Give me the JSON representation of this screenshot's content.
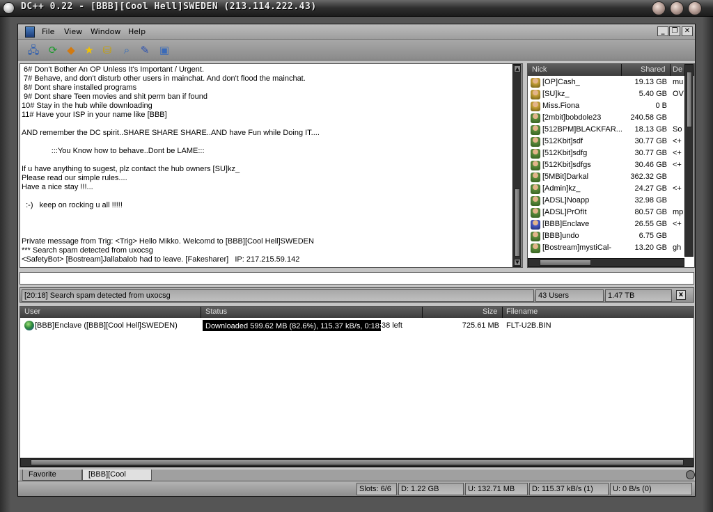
{
  "window": {
    "title": "DC++ 0.22 - [BBB][Cool Hell]SWEDEN (213.114.222.43)"
  },
  "menu": {
    "items": [
      "File",
      "View",
      "Window",
      "Help"
    ]
  },
  "toolbar": {
    "buttons": [
      "connect-icon",
      "refresh-icon",
      "follow-redirect-icon",
      "favorites-icon",
      "download-queue-icon",
      "search-icon",
      "notepad-icon",
      "settings-icon"
    ]
  },
  "chat": {
    "lines": [
      " 6# Don't Bother An OP Unless It's Important / Urgent.",
      " 7# Behave, and don't disturb other users in mainchat. And don't flood the mainchat.",
      " 8# Dont share installed programs",
      " 9# Dont share Teen movies and shit perm ban if found",
      "10# Stay in the hub while downloading",
      "11# Have your ISP in your name like [BBB]",
      "",
      "AND remember the DC spirit..SHARE SHARE SHARE..AND have Fun while Doing IT....",
      "",
      "              :::You Know how to behave..Dont be LAME:::",
      "",
      "If u have anything to sugest, plz contact the hub owners [SU]kz_",
      "Please read our simple rules....",
      "Have a nice stay !!!...",
      "",
      "  :-)   keep on rocking u all !!!!!",
      "",
      "",
      "",
      "Private message from Trig: <Trig> Hello Mikko. Welcomd to [BBB][Cool Hell]SWEDEN",
      "*** Search spam detected from uxocsg",
      "<SafetyBot> [Bostream]Jallabalob had to leave. [Fakesharer]   IP: 217.215.59.142"
    ]
  },
  "userlist": {
    "headers": {
      "nick": "Nick",
      "shared": "Shared",
      "desc": "De"
    },
    "users": [
      {
        "nick": "[OP]Cash_",
        "shared": "19.13 GB",
        "desc": "mu",
        "type": "op"
      },
      {
        "nick": "[SU]kz_",
        "shared": "5.40 GB",
        "desc": "OV",
        "type": "op"
      },
      {
        "nick": "Miss.Fiona",
        "shared": "0 B",
        "desc": "",
        "type": "op"
      },
      {
        "nick": "[2mbit]bobdole23",
        "shared": "240.58 GB",
        "desc": "",
        "type": "normal"
      },
      {
        "nick": "[512BPM]BLACKFAR...",
        "shared": "18.13 GB",
        "desc": "So",
        "type": "normal"
      },
      {
        "nick": "[512Kbit]sdf",
        "shared": "30.77 GB",
        "desc": "<+",
        "type": "normal"
      },
      {
        "nick": "[512Kbit]sdfg",
        "shared": "30.77 GB",
        "desc": "<+",
        "type": "normal"
      },
      {
        "nick": "[512Kbit]sdfgs",
        "shared": "30.46 GB",
        "desc": "<+",
        "type": "normal"
      },
      {
        "nick": "[5MBit]Darkal",
        "shared": "362.32 GB",
        "desc": "",
        "type": "normal"
      },
      {
        "nick": "[Admin]kz_",
        "shared": "24.27 GB",
        "desc": "<+",
        "type": "normal"
      },
      {
        "nick": "[ADSL]Noapp",
        "shared": "32.98 GB",
        "desc": "",
        "type": "normal"
      },
      {
        "nick": "[ADSL]PrOfIt",
        "shared": "80.57 GB",
        "desc": "mp",
        "type": "normal"
      },
      {
        "nick": "[BBB]Enclave",
        "shared": "26.55 GB",
        "desc": "<+",
        "type": "blue"
      },
      {
        "nick": "[BBB]undo",
        "shared": "6.75 GB",
        "desc": "",
        "type": "normal"
      },
      {
        "nick": "[Bostream]mystiCal-",
        "shared": "13.20 GB",
        "desc": "gh",
        "type": "normal"
      }
    ]
  },
  "hub_status": {
    "message": "[20:18] Search spam detected from uxocsg",
    "users": "43 Users",
    "total_share": "1.47 TB",
    "close": "x"
  },
  "queue": {
    "headers": {
      "user": "User",
      "status": "Status",
      "size": "Size",
      "filename": "Filename"
    },
    "row": {
      "user": "[BBB]Enclave ([BBB][Cool Hell]SWEDEN)",
      "status": "Downloaded 599.62 MB (82.6%), 115.37 kB/s, 0:18:38 left",
      "progress": 0.826,
      "size": "725.61 MB",
      "filename": "FLT-U2B.BIN"
    }
  },
  "tabs": [
    "Favorite Hubs",
    "[BBB][Cool Hell]..."
  ],
  "statusbar": {
    "slots": "Slots: 6/6",
    "downloaded": "D: 1.22 GB",
    "uploaded": "U: 132.71 MB",
    "down_rate": "D: 115.37 kB/s (1)",
    "up_rate": "U: 0 B/s (0)"
  },
  "mdi_buttons": [
    "_",
    "❐",
    "✕"
  ]
}
